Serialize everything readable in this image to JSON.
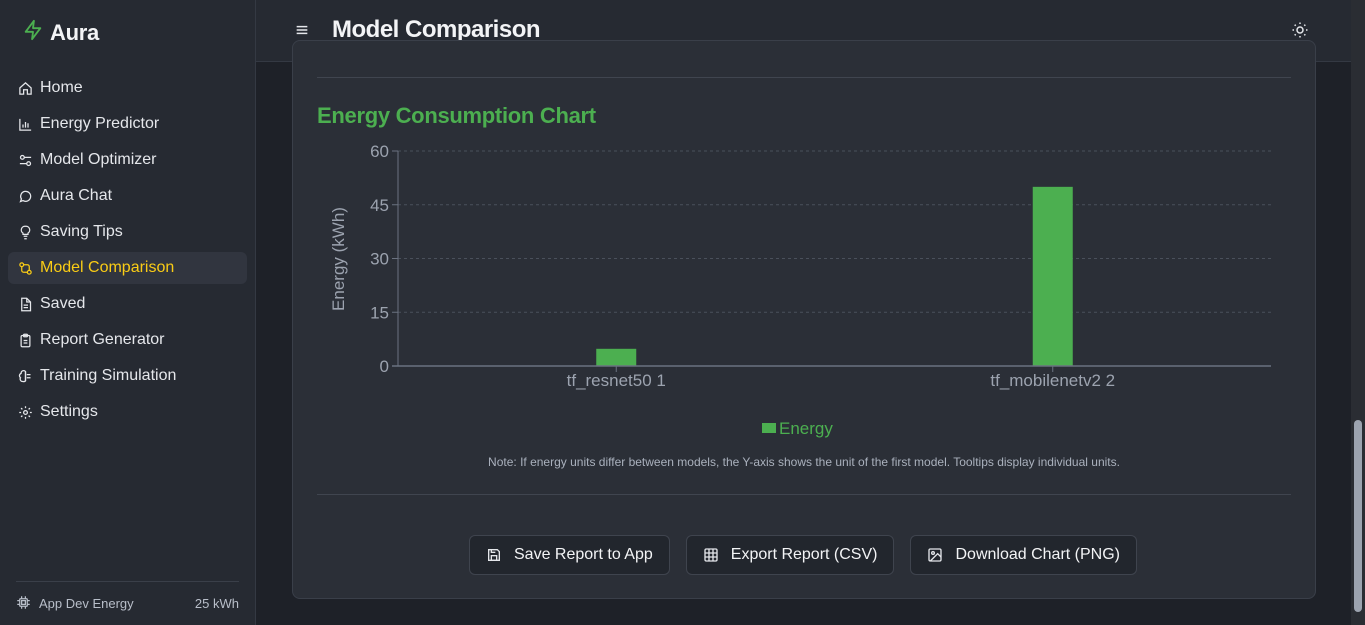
{
  "app": {
    "name": "Aura",
    "icon": "lightning-bolt-icon"
  },
  "sidebar": {
    "items": [
      {
        "label": "Home",
        "icon": "home-icon",
        "active": false
      },
      {
        "label": "Energy Predictor",
        "icon": "bar-chart-icon",
        "active": false
      },
      {
        "label": "Model Optimizer",
        "icon": "sliders-icon",
        "active": false
      },
      {
        "label": "Aura Chat",
        "icon": "chat-bubble-icon",
        "active": false
      },
      {
        "label": "Saving Tips",
        "icon": "lightbulb-icon",
        "active": false
      },
      {
        "label": "Model Comparison",
        "icon": "compare-arrows-icon",
        "active": true
      },
      {
        "label": "Saved",
        "icon": "document-icon",
        "active": false
      },
      {
        "label": "Report Generator",
        "icon": "clipboard-icon",
        "active": false
      },
      {
        "label": "Training Simulation",
        "icon": "brain-icon",
        "active": false
      },
      {
        "label": "Settings",
        "icon": "gear-icon",
        "active": false
      }
    ],
    "footer": {
      "label": "App Dev Energy",
      "value": "25 kWh",
      "icon": "cpu-chip-icon"
    }
  },
  "header": {
    "title": "Model Comparison",
    "menu_icon": "hamburger-menu-icon",
    "theme_icon": "sun-icon"
  },
  "section": {
    "title": "Energy Consumption Chart",
    "note": "Note: If energy units differ between models, the Y-axis shows the unit of the first model. Tooltips display individual units."
  },
  "colors": {
    "accent": "#4caf50",
    "active_nav": "#facc15",
    "bar": "#4caf50"
  },
  "chart_data": {
    "type": "bar",
    "categories": [
      "tf_resnet50 1",
      "tf_mobilenetv2 2"
    ],
    "series": [
      {
        "name": "Energy",
        "values": [
          4.8,
          50
        ]
      }
    ],
    "ylabel": "Energy (kWh)",
    "xlabel": "",
    "ylim": [
      0,
      60
    ],
    "yticks": [
      "0",
      "15",
      "30",
      "45",
      "60"
    ],
    "grid": true,
    "legend": "bottom-center"
  },
  "actions": [
    {
      "label": "Save Report to App",
      "icon": "save-icon"
    },
    {
      "label": "Export Report (CSV)",
      "icon": "table-icon"
    },
    {
      "label": "Download Chart (PNG)",
      "icon": "image-download-icon"
    }
  ]
}
